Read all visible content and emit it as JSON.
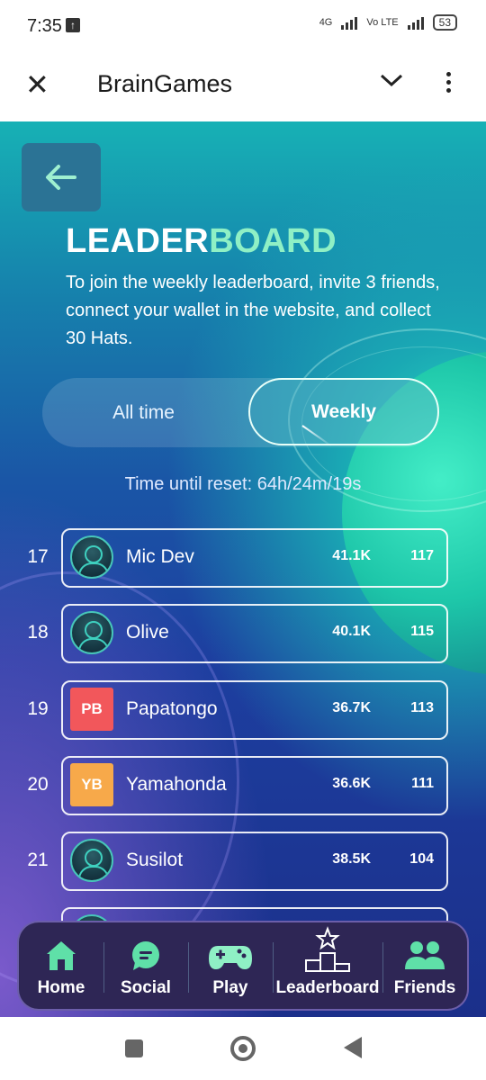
{
  "status": {
    "time": "7:35",
    "net1": "4G",
    "net2": "Vo LTE",
    "battery": "53"
  },
  "appbar": {
    "title": "BrainGames"
  },
  "leaderboard": {
    "title_part1": "LEADER",
    "title_part2": "BOARD",
    "description": "To join the weekly leaderboard, invite 3 friends, connect your wallet in the website, and collect 30 Hats.",
    "tabs": {
      "all_time": "All time",
      "weekly": "Weekly",
      "active": "Weekly"
    },
    "reset_text": "Time until reset: 64h/24m/19s",
    "rows": [
      {
        "rank": "17",
        "name": "Mic Dev",
        "avatar": "placeholder",
        "score": "41.1K",
        "count": "117"
      },
      {
        "rank": "18",
        "name": "Olive",
        "avatar": "placeholder",
        "score": "40.1K",
        "count": "115"
      },
      {
        "rank": "19",
        "name": "Papatongo",
        "avatar": "PB",
        "avatar_color": "#f2575b",
        "score": "36.7K",
        "count": "113"
      },
      {
        "rank": "20",
        "name": "Yamahonda",
        "avatar": "YB",
        "avatar_color": "#f7a94a",
        "score": "36.6K",
        "count": "111"
      },
      {
        "rank": "21",
        "name": "Susilot",
        "avatar": "placeholder",
        "score": "38.5K",
        "count": "104"
      }
    ]
  },
  "nav": {
    "home": "Home",
    "social": "Social",
    "play": "Play",
    "leaderboard": "Leaderboard",
    "friends": "Friends"
  },
  "colors": {
    "accent": "#8ff0c5",
    "nav_bg": "#2e2655"
  }
}
